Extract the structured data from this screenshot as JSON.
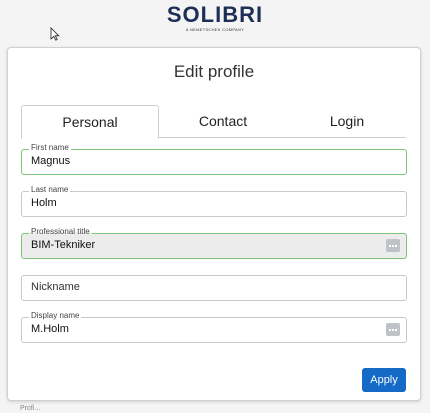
{
  "logo": {
    "brand": "SOLIBRI",
    "tagline": "A NEMETSCHEK COMPANY"
  },
  "dialog": {
    "title": "Edit profile"
  },
  "tabs": [
    {
      "label": "Personal",
      "active": true
    },
    {
      "label": "Contact",
      "active": false
    },
    {
      "label": "Login",
      "active": false
    }
  ],
  "fields": {
    "first_name": {
      "label": "First name",
      "value": "Magnus"
    },
    "last_name": {
      "label": "Last name",
      "value": "Holm"
    },
    "professional_title": {
      "label": "Professional title",
      "value": "BIM-Tekniker"
    },
    "nickname": {
      "placeholder": "Nickname"
    },
    "display_name": {
      "label": "Display name",
      "value": "M.Holm"
    }
  },
  "buttons": {
    "apply": "Apply"
  },
  "footer": {
    "text": "Profi..."
  },
  "colors": {
    "brand": "#1c2f57",
    "accent": "#1569c7",
    "focus": "#7ec67a"
  },
  "icons": {
    "cursor": "mouse-pointer-icon",
    "more": "more-dots-icon"
  }
}
